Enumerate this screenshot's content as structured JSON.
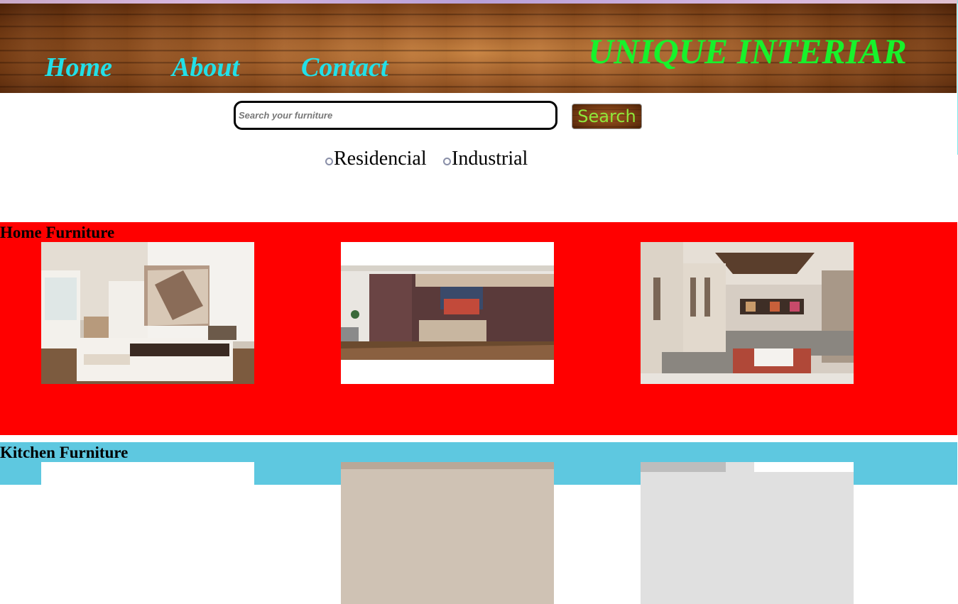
{
  "nav": {
    "home": "Home",
    "about": "About",
    "contact": "Contact"
  },
  "brand": "UNIQUE INTERIAR",
  "search": {
    "placeholder": "Search your furniture",
    "button": "Search"
  },
  "options": [
    {
      "label": "Residencial"
    },
    {
      "label": "Industrial"
    }
  ],
  "sections": [
    {
      "title": "Home Furniture",
      "color": "#ff0000"
    },
    {
      "title": "Kitchen Furniture",
      "color": "#5ec8e0"
    }
  ],
  "colors": {
    "nav_link": "#22e0e8",
    "brand": "#17f22b",
    "search_text": "#8ee83a"
  }
}
